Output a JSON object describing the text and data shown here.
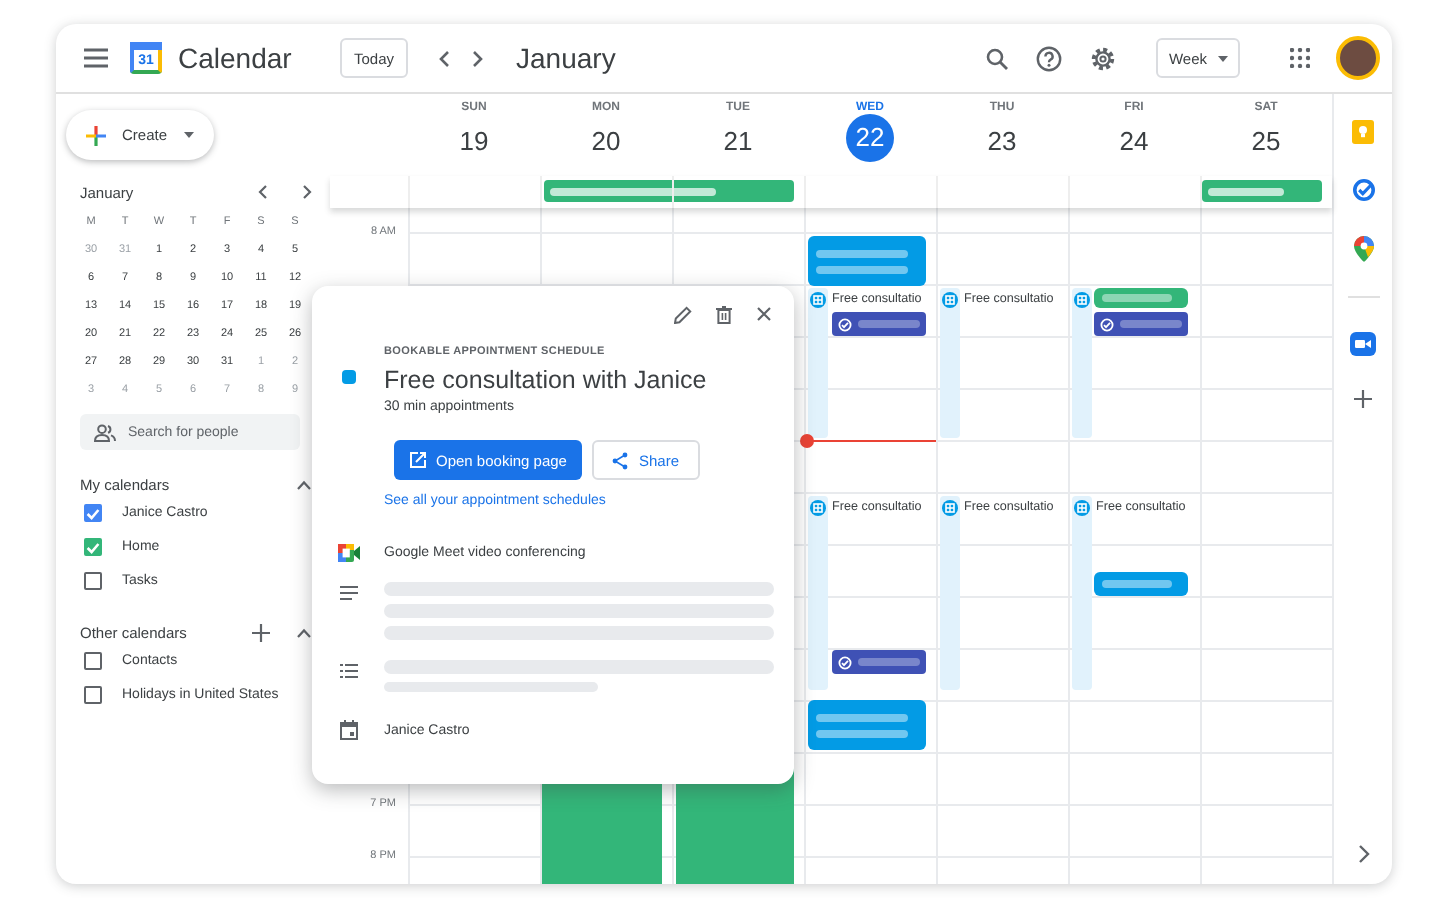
{
  "window": {
    "title": "Calendar",
    "logo_text": "31"
  },
  "header": {
    "today_button": "Today",
    "month": "January",
    "view": "Week"
  },
  "sidebar": {
    "create_button": "Create",
    "mini_calendar": {
      "month": "January",
      "weekdays": [
        "M",
        "T",
        "W",
        "T",
        "F",
        "S",
        "S"
      ],
      "weeks": [
        [
          {
            "label": "30",
            "in_month": false
          },
          {
            "label": "31",
            "in_month": false
          },
          {
            "label": "1",
            "in_month": true
          },
          {
            "label": "2",
            "in_month": true
          },
          {
            "label": "3",
            "in_month": true
          },
          {
            "label": "4",
            "in_month": true
          },
          {
            "label": "5",
            "in_month": true
          }
        ],
        [
          {
            "label": "6",
            "in_month": true
          },
          {
            "label": "7",
            "in_month": true
          },
          {
            "label": "8",
            "in_month": true
          },
          {
            "label": "9",
            "in_month": true
          },
          {
            "label": "10",
            "in_month": true
          },
          {
            "label": "11",
            "in_month": true
          },
          {
            "label": "12",
            "in_month": true
          }
        ],
        [
          {
            "label": "13",
            "in_month": true
          },
          {
            "label": "14",
            "in_month": true
          },
          {
            "label": "15",
            "in_month": true
          },
          {
            "label": "16",
            "in_month": true
          },
          {
            "label": "17",
            "in_month": true
          },
          {
            "label": "18",
            "in_month": true
          },
          {
            "label": "19",
            "in_month": true
          }
        ],
        [
          {
            "label": "20",
            "in_month": true
          },
          {
            "label": "21",
            "in_month": true
          },
          {
            "label": "22",
            "in_month": true
          },
          {
            "label": "23",
            "in_month": true
          },
          {
            "label": "24",
            "in_month": true
          },
          {
            "label": "25",
            "in_month": true
          },
          {
            "label": "26",
            "in_month": true
          }
        ],
        [
          {
            "label": "27",
            "in_month": true
          },
          {
            "label": "28",
            "in_month": true
          },
          {
            "label": "29",
            "in_month": true
          },
          {
            "label": "30",
            "in_month": true
          },
          {
            "label": "31",
            "in_month": true
          },
          {
            "label": "1",
            "in_month": false
          },
          {
            "label": "2",
            "in_month": false
          }
        ],
        [
          {
            "label": "3",
            "in_month": false
          },
          {
            "label": "4",
            "in_month": false
          },
          {
            "label": "5",
            "in_month": false
          },
          {
            "label": "6",
            "in_month": false
          },
          {
            "label": "7",
            "in_month": false
          },
          {
            "label": "8",
            "in_month": false
          },
          {
            "label": "9",
            "in_month": false
          }
        ]
      ]
    },
    "search": {
      "placeholder": "Search for people"
    },
    "my_calendars": {
      "title": "My calendars",
      "items": [
        {
          "label": "Janice Castro",
          "checked": true,
          "color": "#4285f4"
        },
        {
          "label": "Home",
          "checked": true,
          "color": "#33b679"
        },
        {
          "label": "Tasks",
          "checked": false
        }
      ]
    },
    "other_calendars": {
      "title": "Other calendars",
      "items": [
        {
          "label": "Contacts",
          "checked": false
        },
        {
          "label": "Holidays in United States",
          "checked": false
        }
      ]
    }
  },
  "days": [
    {
      "name": "SUN",
      "number": "19",
      "selected": false
    },
    {
      "name": "MON",
      "number": "20",
      "selected": false,
      "all_day": [
        {
          "color": "#33b679"
        }
      ],
      "events": [
        {
          "kind": "block",
          "color": "#33b679"
        }
      ]
    },
    {
      "name": "TUE",
      "number": "21",
      "selected": false,
      "events": [
        {
          "kind": "block",
          "color": "#33b679"
        }
      ]
    },
    {
      "name": "WED",
      "number": "22",
      "selected": true,
      "events": [
        {
          "kind": "block",
          "color": "#039be5"
        },
        {
          "kind": "slot",
          "title": "Free consultatio"
        },
        {
          "kind": "task",
          "color": "#3f51b5"
        },
        {
          "kind": "slot",
          "title": "Free consultatio"
        },
        {
          "kind": "task",
          "color": "#3f51b5"
        },
        {
          "kind": "block",
          "color": "#039be5"
        }
      ]
    },
    {
      "name": "THU",
      "number": "23",
      "selected": false,
      "events": [
        {
          "kind": "slot",
          "title": "Free consultatio"
        },
        {
          "kind": "slot",
          "title": "Free consultatio"
        }
      ]
    },
    {
      "name": "FRI",
      "number": "24",
      "selected": false,
      "events": [
        {
          "kind": "slot"
        },
        {
          "kind": "block",
          "color": "#33b679"
        },
        {
          "kind": "task",
          "color": "#3f51b5"
        },
        {
          "kind": "slot",
          "title": "Free consultatio"
        },
        {
          "kind": "block",
          "color": "#039be5"
        }
      ]
    },
    {
      "name": "SAT",
      "number": "25",
      "selected": false,
      "all_day": [
        {
          "color": "#33b679"
        }
      ]
    }
  ],
  "time_labels": [
    "8 AM",
    "7 PM",
    "8 PM"
  ],
  "popup": {
    "eyebrow": "BOOKABLE APPOINTMENT SCHEDULE",
    "title": "Free consultation with Janice",
    "subtitle": "30 min appointments",
    "primary_button": "Open booking page",
    "share_button": "Share",
    "link": "See all your appointment schedules",
    "conferencing": "Google Meet video conferencing",
    "owner": "Janice Castro"
  }
}
